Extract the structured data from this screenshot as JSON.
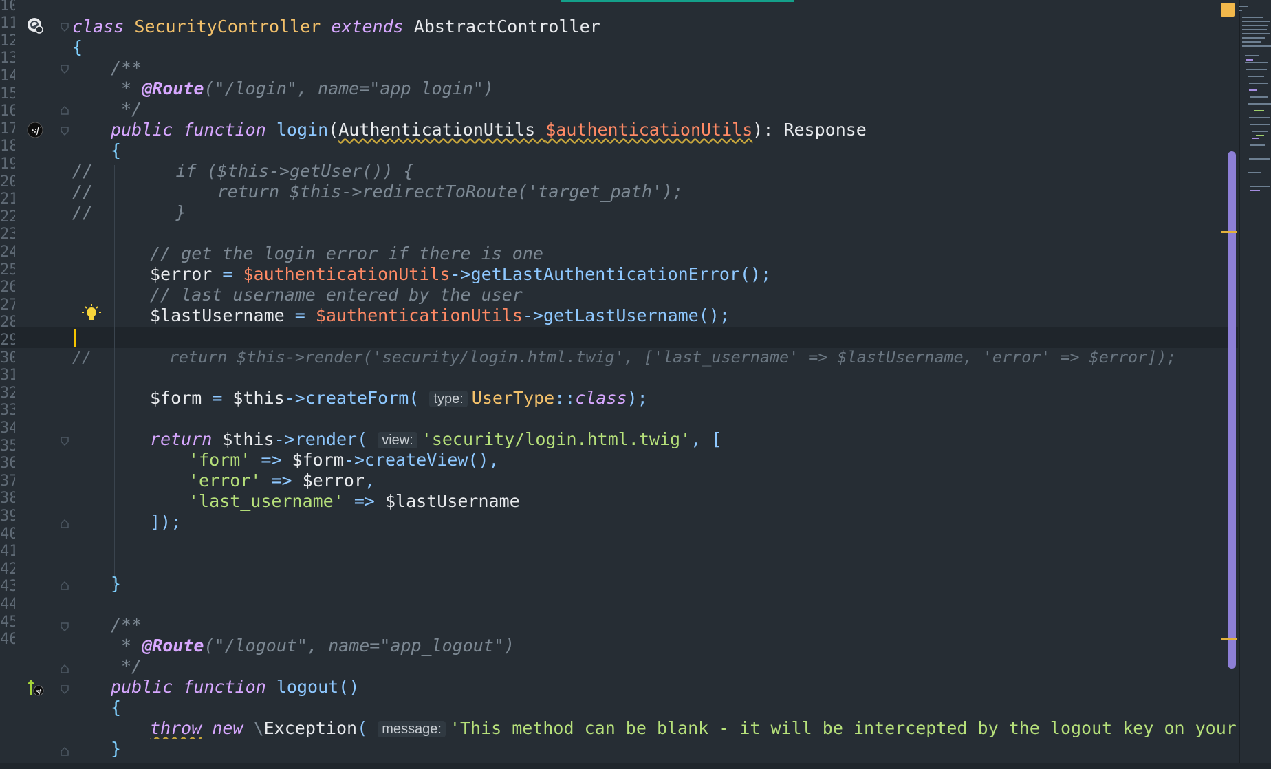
{
  "editor": {
    "line_numbers": [
      "10",
      "11",
      "12",
      "13",
      "14",
      "15",
      "16",
      "17",
      "18",
      "19",
      "20",
      "21",
      "22",
      "23",
      "24",
      "25",
      "26",
      "27",
      "28",
      "29",
      "30",
      "31",
      "32",
      "33",
      "34",
      "35",
      "36",
      "37",
      "38",
      "39",
      "40",
      "41",
      "42",
      "43",
      "44",
      "45",
      "46"
    ],
    "lines": {
      "l11": {
        "kw1": "class",
        "cls": "SecurityController",
        "kw2": "extends",
        "parent": "AbstractController"
      },
      "l12": {
        "brace": "{"
      },
      "l13": {
        "cmt": "/**"
      },
      "l14": {
        "star": " * ",
        "ann": "@Route",
        "rest": "(\"/login\", name=\"app_login\")"
      },
      "l15": {
        "cmt": " */"
      },
      "l16": {
        "kw1": "public",
        "kw2": "function",
        "fn": "login",
        "open": "(",
        "type": "AuthenticationUtils",
        "param": "$authenticationUtils",
        "close": "):",
        "ret": "Response"
      },
      "l17": {
        "brace": "{"
      },
      "l18": {
        "cmt": "//        if ($this->getUser()) {"
      },
      "l19": {
        "cmt": "//            return $this->redirectToRoute('target_path');"
      },
      "l20": {
        "cmt": "//        }"
      },
      "l22": {
        "cmt": "// get the login error if there is one"
      },
      "l23": {
        "var": "$error",
        "eq": " = ",
        "param": "$authenticationUtils",
        "arrow": "->",
        "fn": "getLastAuthenticationError",
        "end": "();"
      },
      "l24": {
        "cmt": "// last username entered by the user"
      },
      "l25": {
        "var": "$lastUsername",
        "eq": " = ",
        "param": "$authenticationUtils",
        "arrow": "->",
        "fn": "getLastUsername",
        "end": "();"
      },
      "l27": {
        "cmt": "//        return $this->render('security/login.html.twig', ['last_username' => $lastUsername, 'error' => $error]);"
      },
      "l29": {
        "var": "$form",
        "eq": " = ",
        "this": "$this",
        "arrow": "->",
        "fn": "createForm",
        "open": "(",
        "hint": "type:",
        "cls": "UserType",
        "sep": "::",
        "kw": "class",
        "end": ");"
      },
      "l31": {
        "kw": "return",
        "this": "$this",
        "arrow": "->",
        "fn": "render",
        "open": "(",
        "hint": "view:",
        "str": "'security/login.html.twig'",
        "end": ", ["
      },
      "l32": {
        "key": "'form'",
        "arrow": " => ",
        "var": "$form",
        "arr2": "->",
        "fn": "createView",
        "end": "(),"
      },
      "l33": {
        "key": "'error'",
        "arrow": " => ",
        "var": "$error",
        "end": ","
      },
      "l34": {
        "key": "'last_username'",
        "arrow": " => ",
        "var": "$lastUsername"
      },
      "l35": {
        "end": "]);"
      },
      "l38": {
        "brace": "}"
      },
      "l40": {
        "cmt": "/**"
      },
      "l41": {
        "star": " * ",
        "ann": "@Route",
        "rest": "(\"/logout\", name=\"app_logout\")"
      },
      "l42": {
        "cmt": " */"
      },
      "l43": {
        "kw1": "public",
        "kw2": "function",
        "fn": "logout",
        "end": "()"
      },
      "l44": {
        "brace": "{"
      },
      "l45": {
        "kw1": "throw",
        "kw2": "new",
        "ns": "\\",
        "cls": "Exception",
        "open": "(",
        "hint": "message:",
        "str": "'This method can be blank - it will be intercepted by the logout key on your firewal"
      },
      "l46": {
        "brace": "}"
      }
    }
  },
  "icons": {
    "class_icon": "globe-marker-icon",
    "symfony_icon": "symfony-icon",
    "bulb_icon": "lightbulb-icon",
    "route_icon": "route-arrow-icon"
  },
  "colors": {
    "background": "#262d34",
    "keyword": "#d7a7ff",
    "string": "#b6e07a",
    "function": "#8ec8ff",
    "parameter": "#ff8a65",
    "class": "#f2c06a",
    "comment": "#7c8893",
    "caret": "#f5c400",
    "scrollbar": "#8d7fd6"
  }
}
